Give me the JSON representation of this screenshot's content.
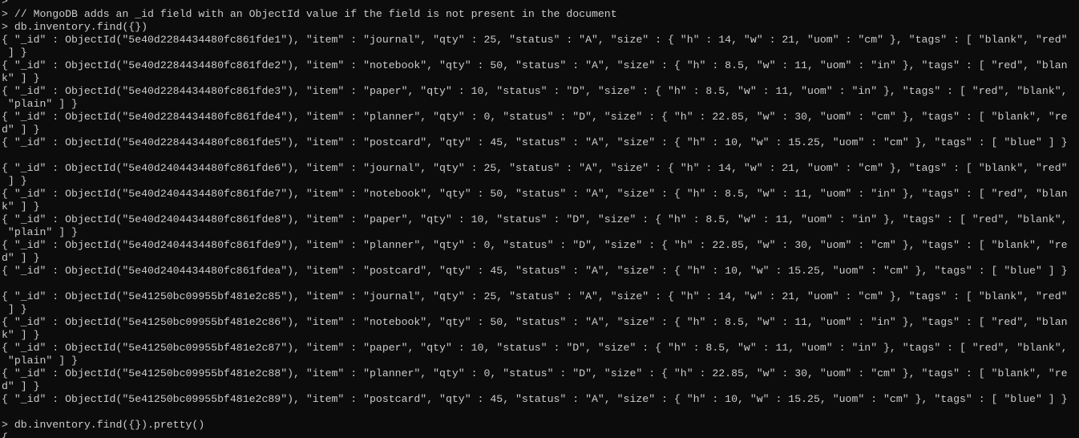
{
  "terminal": {
    "lines": [
      ">",
      "> // MongoDB adds an _id field with an ObjectId value if the field is not present in the document",
      "> db.inventory.find({})",
      "{ \"_id\" : ObjectId(\"5e40d2284434480fc861fde1\"), \"item\" : \"journal\", \"qty\" : 25, \"status\" : \"A\", \"size\" : { \"h\" : 14, \"w\" : 21, \"uom\" : \"cm\" }, \"tags\" : [ \"blank\", \"red\"",
      " ] }",
      "{ \"_id\" : ObjectId(\"5e40d2284434480fc861fde2\"), \"item\" : \"notebook\", \"qty\" : 50, \"status\" : \"A\", \"size\" : { \"h\" : 8.5, \"w\" : 11, \"uom\" : \"in\" }, \"tags\" : [ \"red\", \"blan",
      "k\" ] }",
      "{ \"_id\" : ObjectId(\"5e40d2284434480fc861fde3\"), \"item\" : \"paper\", \"qty\" : 10, \"status\" : \"D\", \"size\" : { \"h\" : 8.5, \"w\" : 11, \"uom\" : \"in\" }, \"tags\" : [ \"red\", \"blank\",",
      " \"plain\" ] }",
      "{ \"_id\" : ObjectId(\"5e40d2284434480fc861fde4\"), \"item\" : \"planner\", \"qty\" : 0, \"status\" : \"D\", \"size\" : { \"h\" : 22.85, \"w\" : 30, \"uom\" : \"cm\" }, \"tags\" : [ \"blank\", \"re",
      "d\" ] }",
      "{ \"_id\" : ObjectId(\"5e40d2284434480fc861fde5\"), \"item\" : \"postcard\", \"qty\" : 45, \"status\" : \"A\", \"size\" : { \"h\" : 10, \"w\" : 15.25, \"uom\" : \"cm\" }, \"tags\" : [ \"blue\" ] }",
      "",
      "{ \"_id\" : ObjectId(\"5e40d2404434480fc861fde6\"), \"item\" : \"journal\", \"qty\" : 25, \"status\" : \"A\", \"size\" : { \"h\" : 14, \"w\" : 21, \"uom\" : \"cm\" }, \"tags\" : [ \"blank\", \"red\"",
      " ] }",
      "{ \"_id\" : ObjectId(\"5e40d2404434480fc861fde7\"), \"item\" : \"notebook\", \"qty\" : 50, \"status\" : \"A\", \"size\" : { \"h\" : 8.5, \"w\" : 11, \"uom\" : \"in\" }, \"tags\" : [ \"red\", \"blan",
      "k\" ] }",
      "{ \"_id\" : ObjectId(\"5e40d2404434480fc861fde8\"), \"item\" : \"paper\", \"qty\" : 10, \"status\" : \"D\", \"size\" : { \"h\" : 8.5, \"w\" : 11, \"uom\" : \"in\" }, \"tags\" : [ \"red\", \"blank\",",
      " \"plain\" ] }",
      "{ \"_id\" : ObjectId(\"5e40d2404434480fc861fde9\"), \"item\" : \"planner\", \"qty\" : 0, \"status\" : \"D\", \"size\" : { \"h\" : 22.85, \"w\" : 30, \"uom\" : \"cm\" }, \"tags\" : [ \"blank\", \"re",
      "d\" ] }",
      "{ \"_id\" : ObjectId(\"5e40d2404434480fc861fdea\"), \"item\" : \"postcard\", \"qty\" : 45, \"status\" : \"A\", \"size\" : { \"h\" : 10, \"w\" : 15.25, \"uom\" : \"cm\" }, \"tags\" : [ \"blue\" ] }",
      "",
      "{ \"_id\" : ObjectId(\"5e41250bc09955bf481e2c85\"), \"item\" : \"journal\", \"qty\" : 25, \"status\" : \"A\", \"size\" : { \"h\" : 14, \"w\" : 21, \"uom\" : \"cm\" }, \"tags\" : [ \"blank\", \"red\"",
      " ] }",
      "{ \"_id\" : ObjectId(\"5e41250bc09955bf481e2c86\"), \"item\" : \"notebook\", \"qty\" : 50, \"status\" : \"A\", \"size\" : { \"h\" : 8.5, \"w\" : 11, \"uom\" : \"in\" }, \"tags\" : [ \"red\", \"blan",
      "k\" ] }",
      "{ \"_id\" : ObjectId(\"5e41250bc09955bf481e2c87\"), \"item\" : \"paper\", \"qty\" : 10, \"status\" : \"D\", \"size\" : { \"h\" : 8.5, \"w\" : 11, \"uom\" : \"in\" }, \"tags\" : [ \"red\", \"blank\",",
      " \"plain\" ] }",
      "{ \"_id\" : ObjectId(\"5e41250bc09955bf481e2c88\"), \"item\" : \"planner\", \"qty\" : 0, \"status\" : \"D\", \"size\" : { \"h\" : 22.85, \"w\" : 30, \"uom\" : \"cm\" }, \"tags\" : [ \"blank\", \"re",
      "d\" ] }",
      "{ \"_id\" : ObjectId(\"5e41250bc09955bf481e2c89\"), \"item\" : \"postcard\", \"qty\" : 45, \"status\" : \"A\", \"size\" : { \"h\" : 10, \"w\" : 15.25, \"uom\" : \"cm\" }, \"tags\" : [ \"blue\" ] }",
      "",
      "> db.inventory.find({}).pretty()",
      "{"
    ]
  }
}
